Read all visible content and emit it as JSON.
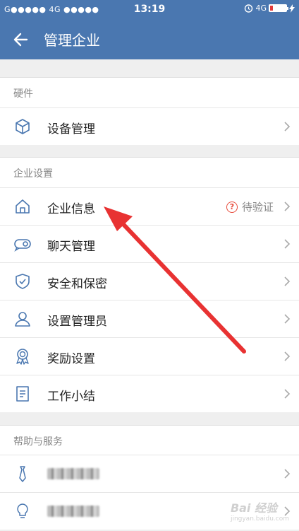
{
  "status": {
    "carrier": "G●●●●● 4G ●●●●●",
    "time": "13:19",
    "network": "4G"
  },
  "header": {
    "title": "管理企业"
  },
  "sections": [
    {
      "title": "硬件",
      "items": [
        {
          "label": "设备管理",
          "icon": "cube-icon"
        }
      ]
    },
    {
      "title": "企业设置",
      "items": [
        {
          "label": "企业信息",
          "icon": "home-icon",
          "status": "待验证"
        },
        {
          "label": "聊天管理",
          "icon": "chat-bubble-icon"
        },
        {
          "label": "安全和保密",
          "icon": "shield-check-icon"
        },
        {
          "label": "设置管理员",
          "icon": "person-icon"
        },
        {
          "label": "奖励设置",
          "icon": "award-medal-icon"
        },
        {
          "label": "工作小结",
          "icon": "document-icon"
        }
      ]
    },
    {
      "title": "帮助与服务",
      "items": [
        {
          "label": "",
          "icon": "tie-icon",
          "blurred": true
        },
        {
          "label": "",
          "icon": "lightbulb-icon",
          "blurred": true
        }
      ]
    }
  ],
  "watermark": {
    "text": "Bai 经验",
    "sub": "jingyan.baidu.com"
  },
  "colors": {
    "header": "#4a77b0",
    "icon": "#4a77b0",
    "annotation_arrow": "#e83232",
    "warning": "#e74c3c"
  }
}
